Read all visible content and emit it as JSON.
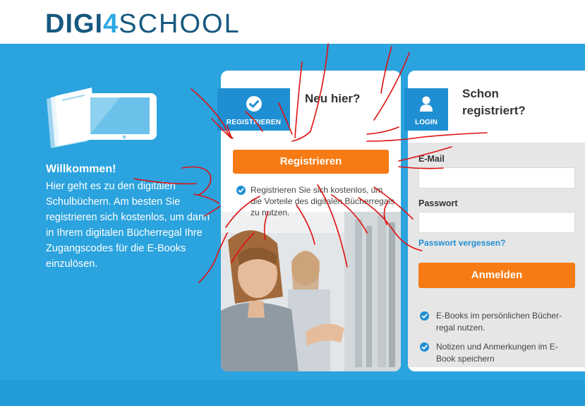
{
  "header": {
    "logo_part1": "DIGI",
    "logo_part2": "4",
    "logo_part3": "SCHOOL"
  },
  "welcome": {
    "title": "Willkommen!",
    "text": "Hier geht es zu den digitalen Schulbüchern. Am besten Sie registrieren sich kostenlos, um dann in Ihrem digitalen Bücherregal Ihre Zugangscodes für die E-Books einzulösen."
  },
  "register": {
    "tab_label": "REGISTRIEREN",
    "heading": "Neu hier?",
    "button_label": "Registrieren",
    "note": "Registrieren Sie sich kostenlos, um die Vorteile des digitalen Bücherregals zu nutzen."
  },
  "login": {
    "tab_label": "LOGIN",
    "heading": "Schon registriert?",
    "email_label": "E-Mail",
    "email_value": "",
    "password_label": "Passwort",
    "password_value": "",
    "forgot_link": "Passwort vergessen?",
    "button_label": "Anmelden",
    "benefits": [
      "E-Books im persönlichen Bücher-regal nutzen.",
      "Notizen und Anmerkungen im E-Book speichern"
    ]
  },
  "colors": {
    "brand_blue": "#2ba3de",
    "dark_blue": "#17587f",
    "accent_orange": "#f77b14",
    "scribble_red": "#e01010"
  }
}
